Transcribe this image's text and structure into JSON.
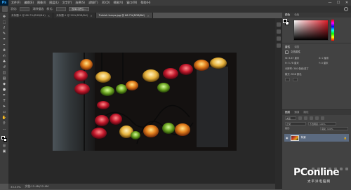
{
  "app": {
    "logo": "Ps"
  },
  "menu": [
    "文件(F)",
    "编辑(E)",
    "图像(I)",
    "图层(L)",
    "文字(Y)",
    "选择(S)",
    "滤镜(T)",
    "3D(D)",
    "视图(V)",
    "窗口(W)",
    "帮助(H)"
  ],
  "window_controls": {
    "minimize": "—",
    "maximize": "☐",
    "close": "✕"
  },
  "options_bar": {
    "label_1": "羽化:",
    "label_2": "消除锯齿",
    "label_3": "样式:",
    "button": "选择并遮住..."
  },
  "tabs": [
    {
      "label": "未标题-1 @ 66.7%(RGB/8#)",
      "active": false
    },
    {
      "label": "未标题-1 @ 50%(RGB/8#)",
      "active": false
    },
    {
      "label": "Turkish lamps.jpg @ 66.7%(RGB/8#)",
      "active": true
    }
  ],
  "status": {
    "zoom": "33.33%",
    "doc": "文档:12.4M/12.4M"
  },
  "right_panel": {
    "tabs": [
      "颜色",
      "色板"
    ],
    "active_tab": "颜色",
    "properties_tabs": [
      "属性",
      "调整"
    ],
    "properties_title": "文档属性",
    "fields": [
      "W: 8.67 厘米",
      "X: 0 厘米",
      "H: 5.78 厘米",
      "Y: 0 厘米"
    ],
    "resolution": "分辨率: 300 像素/英寸",
    "mode": "模式: RGB 颜色"
  },
  "layers_panel": {
    "tabs": [
      "图层",
      "通道",
      "路径"
    ],
    "active_tab": "图层",
    "filter_label": "类型",
    "blend_mode": "正常",
    "opacity": "不透明度: 100%",
    "lock_label": "锁定:",
    "fill": "填充: 100%",
    "layer_name": "背景"
  },
  "watermark": {
    "brand": "PConline",
    "sub": "太平洋电脑网"
  }
}
